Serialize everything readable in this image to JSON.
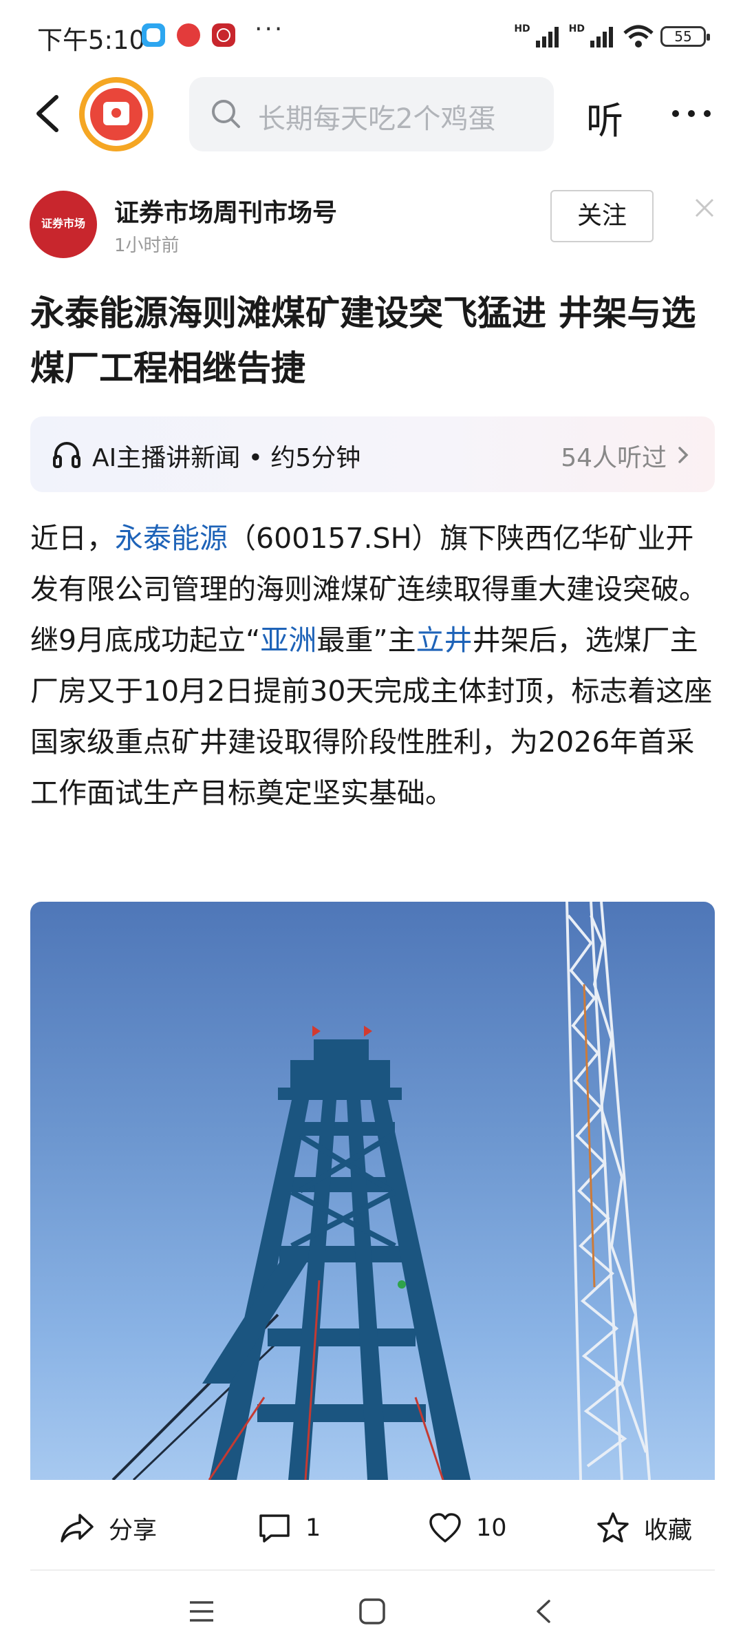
{
  "status_bar": {
    "time": "下午5:10",
    "more": "···",
    "battery": "55",
    "hd1": "HD",
    "hd2": "HD"
  },
  "nav": {
    "search_placeholder": "长期每天吃2个鸡蛋",
    "listen_label": "听"
  },
  "author": {
    "avatar_text": "证券市场",
    "name": "证券市场周刊市场号",
    "time": "1小时前",
    "follow_label": "关注"
  },
  "article": {
    "title": "永泰能源海则滩煤矿建设突飞猛进 井架与选煤厂工程相继告捷",
    "ai_label": "AI主播讲新闻 • 约5分钟",
    "ai_listeners": "54人听过",
    "body": {
      "p1": "近日，",
      "link1": "永泰能源",
      "p2": "（600157.SH）旗下陕西亿华矿业开发有限公司管理的海则滩煤矿连续取得重大建设突破。继9月底成功起立“",
      "link2": "亚洲",
      "p3": "最重”主",
      "link3": "立井",
      "p4": "井架后，选煤厂主厂房又于10月2日提前30天完成主体封顶，标志着这座国家级重点矿井建设取得阶段性胜利，为2026年首采工作面试生产目标奠定坚实基础。"
    }
  },
  "actions": {
    "share_label": "分享",
    "comment_count": "1",
    "like_count": "10",
    "favorite_label": "收藏"
  },
  "colors": {
    "link": "#1e63b8",
    "logo_ring": "#f5a623",
    "logo_fill": "#e9463a",
    "avatar": "#c8262d"
  }
}
